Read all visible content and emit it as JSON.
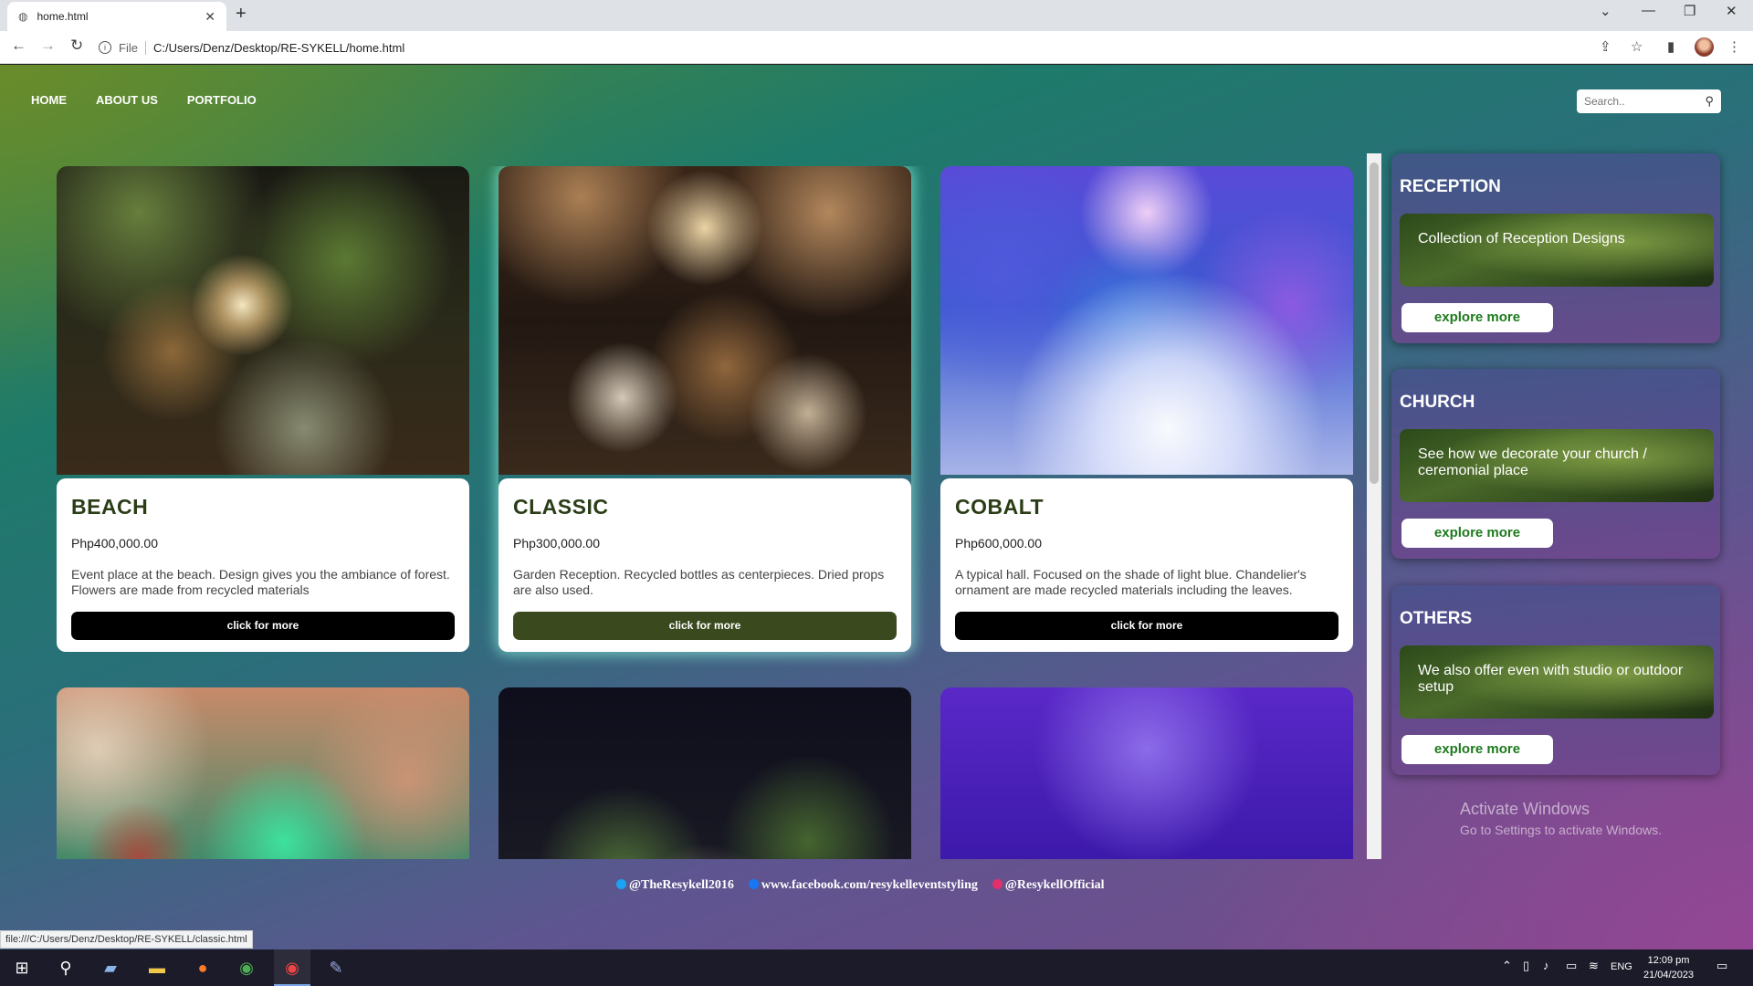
{
  "browser": {
    "tab_title": "home.html",
    "tab_close": "✕",
    "new_tab": "+",
    "url_scheme": "File",
    "url": "C:/Users/Denz/Desktop/RE-SYKELL/home.html",
    "status_link": "file:///C:/Users/Denz/Desktop/RE-SYKELL/classic.html"
  },
  "nav": {
    "items": [
      "HOME",
      "ABOUT US",
      "PORTFOLIO"
    ]
  },
  "search": {
    "placeholder": "Search.."
  },
  "cards": [
    {
      "title": "BEACH",
      "price": "Php400,000.00",
      "desc": "Event place at the beach. Design gives you the ambiance of forest. Flowers are made from recycled materials",
      "button": "click for more"
    },
    {
      "title": "CLASSIC",
      "price": "Php300,000.00",
      "desc": "Garden Reception. Recycled bottles as centerpieces. Dried props are also used.",
      "button": "click for more"
    },
    {
      "title": "COBALT",
      "price": "Php600,000.00",
      "desc": "A typical hall. Focused on the shade of light blue. Chandelier's ornament are made recycled materials including the leaves.",
      "button": "click for more"
    }
  ],
  "sidebar": [
    {
      "title": "RECEPTION",
      "banner": "Collection of Reception Designs",
      "button": "explore more"
    },
    {
      "title": "CHURCH",
      "banner": "See how we decorate your church / ceremonial place",
      "button": "explore more"
    },
    {
      "title": "OTHERS",
      "banner": "We also offer even with studio or outdoor setup",
      "button": "explore more"
    }
  ],
  "footer": {
    "twitter": "@TheResykell2016",
    "facebook": "www.facebook.com/resykelleventstyling",
    "instagram": "@ResykellOfficial"
  },
  "watermark": {
    "line1": "Activate Windows",
    "line2": "Go to Settings to activate Windows."
  },
  "taskbar": {
    "lang": "ENG",
    "time": "12:09 pm",
    "date": "21/04/2023"
  },
  "colors": {
    "card_title": "#2b3d17",
    "highlight_button": "#3a4a1e",
    "explore_text": "#1d7a1d"
  }
}
